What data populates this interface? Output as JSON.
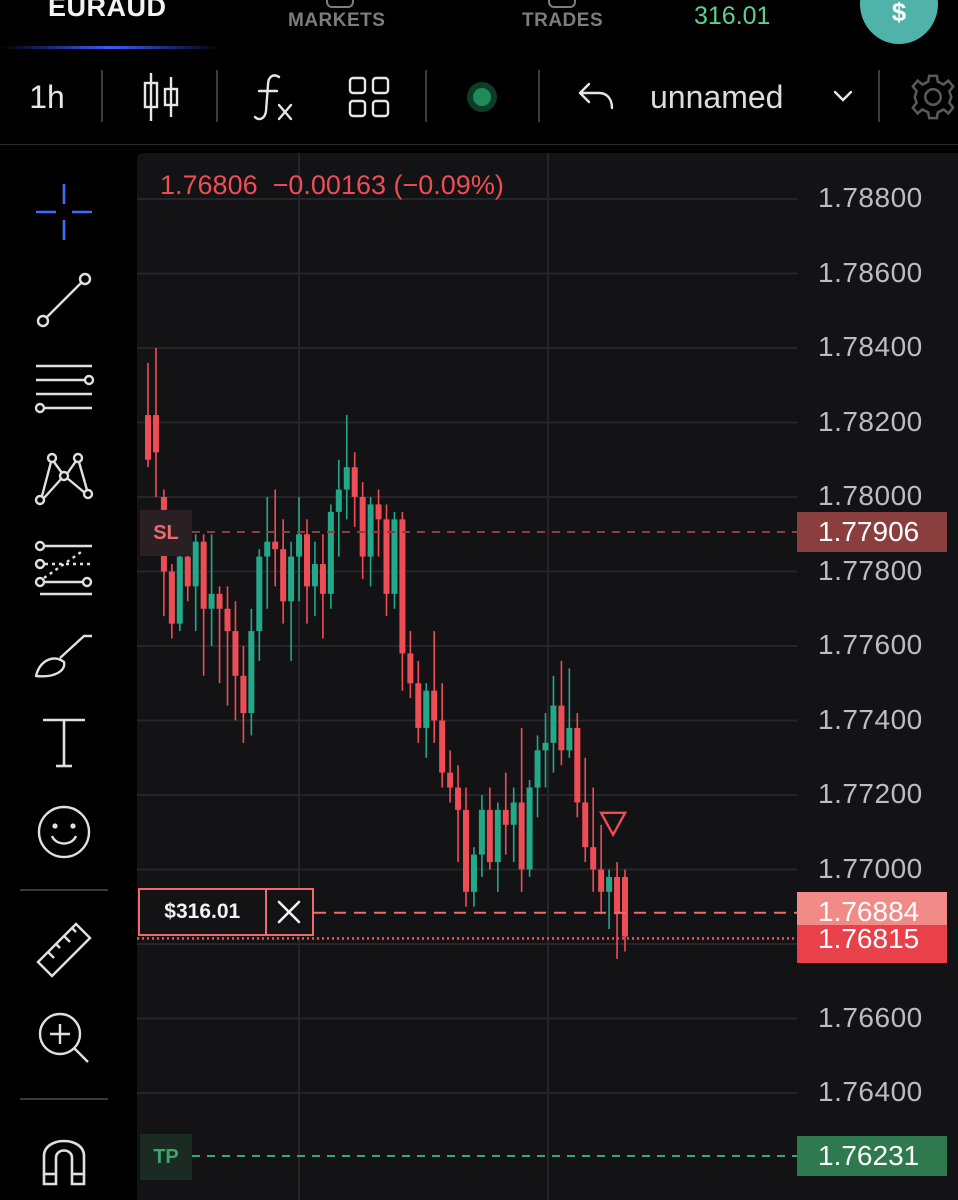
{
  "header": {
    "symbol": "EURAUD",
    "tabs": [
      {
        "label": "MARKETS",
        "icon": "markets-icon"
      },
      {
        "label": "TRADES",
        "icon": "trades-icon"
      }
    ],
    "balance": "316.01",
    "deposit_label": "$"
  },
  "toolbar": {
    "timeframe": "1h",
    "chart_type_icon": "candlestick-icon",
    "indicators_icon": "fx-icon",
    "layout_icon": "grid-layout-icon",
    "status_icon": "green-dot-icon",
    "undo_icon": "undo-icon",
    "layout_name": "unnamed",
    "dropdown_icon": "chevron-down-icon",
    "settings_icon": "gear-icon"
  },
  "left_tools": [
    "crosshair-icon",
    "trend-line-icon",
    "horizontal-lines-icon",
    "pattern-icon",
    "fib-icon",
    "brush-icon",
    "text-icon",
    "emoji-icon",
    "ruler-icon",
    "zoom-in-icon",
    "magnet-icon"
  ],
  "colors": {
    "up": "#23a888",
    "down": "#ef4d55",
    "sl": "#ef6b6b",
    "tp": "#3aa86b",
    "background": "#131315"
  },
  "chart_data": {
    "type": "candlestick",
    "ohlc_readout": {
      "last": "1.76806",
      "change": "−0.00163",
      "change_pct": "(−0.09%)"
    },
    "y_axis_ticks": [
      "1.78800",
      "1.78600",
      "1.78400",
      "1.78200",
      "1.78000",
      "1.77800",
      "1.77600",
      "1.77400",
      "1.77200",
      "1.77000",
      "1.76600",
      "1.76400"
    ],
    "ylim": [
      1.7612,
      1.7894
    ],
    "levels": {
      "stop_loss": {
        "label": "SL",
        "price": "1.77906"
      },
      "position": {
        "pnl": "$316.01",
        "price": "1.76884"
      },
      "current": {
        "price": "1.76815"
      },
      "take_profit": {
        "label": "TP",
        "price": "1.76231"
      }
    },
    "sell_marker_price": 1.7712,
    "candles": [
      [
        1.7822,
        1.7836,
        1.7808,
        1.781
      ],
      [
        1.7822,
        1.784,
        1.78,
        1.7812
      ],
      [
        1.78,
        1.7802,
        1.7768,
        1.778
      ],
      [
        1.778,
        1.7782,
        1.7762,
        1.7766
      ],
      [
        1.7766,
        1.7788,
        1.7764,
        1.7784
      ],
      [
        1.7784,
        1.7796,
        1.7772,
        1.7776
      ],
      [
        1.7776,
        1.779,
        1.7764,
        1.7788
      ],
      [
        1.7788,
        1.779,
        1.7752,
        1.777
      ],
      [
        1.777,
        1.779,
        1.776,
        1.7774
      ],
      [
        1.7774,
        1.7776,
        1.775,
        1.777
      ],
      [
        1.777,
        1.7776,
        1.7744,
        1.7764
      ],
      [
        1.7764,
        1.7772,
        1.774,
        1.7752
      ],
      [
        1.7752,
        1.776,
        1.7734,
        1.7742
      ],
      [
        1.7742,
        1.777,
        1.7736,
        1.7764
      ],
      [
        1.7764,
        1.7786,
        1.7756,
        1.7784
      ],
      [
        1.7784,
        1.78,
        1.777,
        1.7788
      ],
      [
        1.7788,
        1.7802,
        1.7776,
        1.7786
      ],
      [
        1.7786,
        1.7794,
        1.7766,
        1.7772
      ],
      [
        1.7772,
        1.7788,
        1.7756,
        1.7784
      ],
      [
        1.7784,
        1.78,
        1.7772,
        1.779
      ],
      [
        1.779,
        1.7794,
        1.7766,
        1.7776
      ],
      [
        1.7776,
        1.7788,
        1.7768,
        1.7782
      ],
      [
        1.7782,
        1.779,
        1.7762,
        1.7774
      ],
      [
        1.7774,
        1.7798,
        1.777,
        1.7796
      ],
      [
        1.7796,
        1.781,
        1.7784,
        1.7802
      ],
      [
        1.7802,
        1.7822,
        1.7794,
        1.7808
      ],
      [
        1.7808,
        1.7812,
        1.7792,
        1.78
      ],
      [
        1.78,
        1.7804,
        1.7778,
        1.7784
      ],
      [
        1.7784,
        1.78,
        1.7776,
        1.7798
      ],
      [
        1.7798,
        1.7802,
        1.7784,
        1.7794
      ],
      [
        1.7794,
        1.7798,
        1.7768,
        1.7774
      ],
      [
        1.7774,
        1.7796,
        1.777,
        1.7794
      ],
      [
        1.7794,
        1.7796,
        1.7748,
        1.7758
      ],
      [
        1.7758,
        1.7764,
        1.7746,
        1.775
      ],
      [
        1.775,
        1.7756,
        1.7734,
        1.7738
      ],
      [
        1.7738,
        1.775,
        1.773,
        1.7748
      ],
      [
        1.7748,
        1.7764,
        1.7734,
        1.774
      ],
      [
        1.774,
        1.775,
        1.7722,
        1.7726
      ],
      [
        1.7726,
        1.7732,
        1.7718,
        1.7722
      ],
      [
        1.7722,
        1.7728,
        1.7702,
        1.7716
      ],
      [
        1.7716,
        1.7722,
        1.769,
        1.7694
      ],
      [
        1.7694,
        1.7706,
        1.769,
        1.7704
      ],
      [
        1.7704,
        1.772,
        1.7698,
        1.7716
      ],
      [
        1.7716,
        1.7722,
        1.77,
        1.7702
      ],
      [
        1.7702,
        1.7718,
        1.7694,
        1.7716
      ],
      [
        1.7716,
        1.7726,
        1.7704,
        1.7712
      ],
      [
        1.7712,
        1.7722,
        1.7702,
        1.7718
      ],
      [
        1.7718,
        1.7738,
        1.7694,
        1.77
      ],
      [
        1.77,
        1.7724,
        1.7698,
        1.7722
      ],
      [
        1.7722,
        1.7736,
        1.7714,
        1.7732
      ],
      [
        1.7732,
        1.7742,
        1.7722,
        1.7734
      ],
      [
        1.7734,
        1.7752,
        1.7726,
        1.7744
      ],
      [
        1.7744,
        1.7756,
        1.7728,
        1.7732
      ],
      [
        1.7732,
        1.7754,
        1.773,
        1.7738
      ],
      [
        1.7738,
        1.7742,
        1.7714,
        1.7718
      ],
      [
        1.7718,
        1.773,
        1.7702,
        1.7706
      ],
      [
        1.7706,
        1.7722,
        1.7694,
        1.77
      ],
      [
        1.77,
        1.7712,
        1.7688,
        1.7694
      ],
      [
        1.7694,
        1.77,
        1.7684,
        1.7698
      ],
      [
        1.7698,
        1.7702,
        1.7676,
        1.7688
      ],
      [
        1.7698,
        1.77,
        1.7678,
        1.7682
      ]
    ]
  }
}
